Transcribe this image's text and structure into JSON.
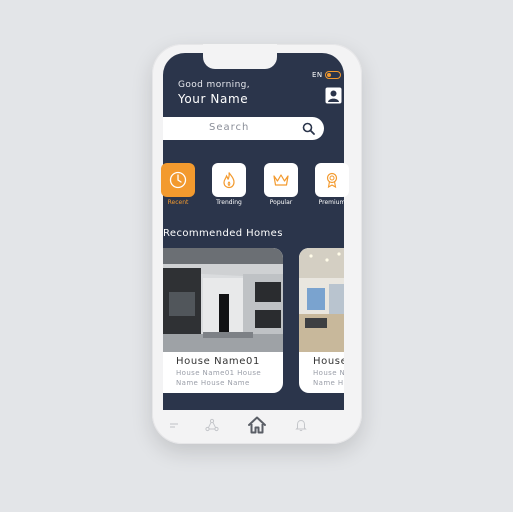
{
  "status": {
    "language": "EN"
  },
  "header": {
    "greeting": "Good morning,",
    "user_name": "Your Name"
  },
  "search": {
    "placeholder": "Search"
  },
  "categories": [
    {
      "label": "Recent",
      "icon": "clock-icon",
      "active": true
    },
    {
      "label": "Trending",
      "icon": "flame-icon",
      "active": false
    },
    {
      "label": "Popular",
      "icon": "crown-icon",
      "active": false
    },
    {
      "label": "Premium",
      "icon": "award-icon",
      "active": false
    }
  ],
  "recommended": {
    "title": "Recommended Homes",
    "cards": [
      {
        "name": "House Name01",
        "line1": "House Name01 House",
        "line2": "Name House Name"
      },
      {
        "name": "House",
        "line1": "House N",
        "line2": "Name H"
      }
    ]
  },
  "colors": {
    "accent": "#f39a2e",
    "screen_bg": "#2b354b"
  },
  "bottom_nav": [
    "menu-icon",
    "share-icon",
    "home-icon",
    "bell-icon"
  ]
}
